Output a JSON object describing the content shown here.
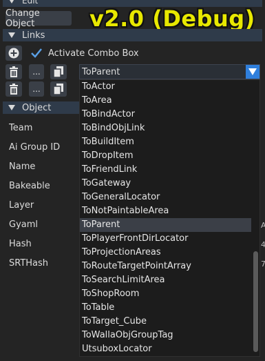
{
  "sections": {
    "edit": "Edit",
    "links": "Links",
    "object": "Object"
  },
  "buttons": {
    "change_object": "Change Object",
    "ellipsis": "..."
  },
  "watermark": "v2.0 (Debug)",
  "links": {
    "activate_combo_label": "Activate Combo Box",
    "activate_checked": true
  },
  "properties": {
    "team": "Team",
    "ai_group_id": "Ai Group ID",
    "name": "Name",
    "bakeable": "Bakeable",
    "layer": "Layer",
    "gyaml": "Gyaml",
    "hash": "Hash",
    "srthash": "SRTHash"
  },
  "combo": {
    "selected": "ToParent",
    "options": [
      "ToActor",
      "ToArea",
      "ToBindActor",
      "ToBindObjLink",
      "ToBuildItem",
      "ToDropItem",
      "ToFriendLink",
      "ToGateway",
      "ToGeneralLocator",
      "ToNotPaintableArea",
      "ToParent",
      "ToPlayerFrontDirLocator",
      "ToProjectionAreas",
      "ToRouteTargetPointArray",
      "ToSearchLimitArea",
      "ToShopRoom",
      "ToTable",
      "ToTarget_Cube",
      "ToWallaObjGroupTag",
      "UtsuboxLocator"
    ]
  },
  "clipped_right": {
    "gyaml_tail": "A",
    "hash_tail": "4",
    "srthash_tail": "7"
  },
  "colors": {
    "accent": "#2f7fdc",
    "header_bg": "#2f3b4a",
    "watermark": "#e8e800"
  }
}
